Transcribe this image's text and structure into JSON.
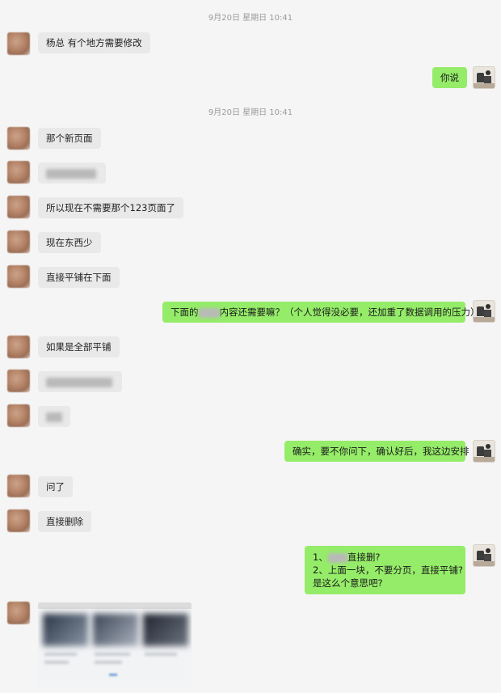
{
  "chat": {
    "timestamps": [
      "9月20日 星期日 10:41",
      "9月20日 星期日 10:41"
    ],
    "messages": {
      "m1": "杨总 有个地方需要修改",
      "m2": "你说",
      "m3": "那个新页面",
      "m5": "所以现在不需要那个123页面了",
      "m6": "现在东西少",
      "m7": "直接平铺在下面",
      "m8_pre": "下面的",
      "m8_post": "内容还需要嘛？（个人觉得没必要，还加重了数据调用的压力）",
      "m9": "如果是全部平铺",
      "m12": "确实，要不你问下，确认好后，我这边安排",
      "m13": "问了",
      "m14": "直接删除",
      "m15_line1_pre": "1、",
      "m15_line1_post": "直接删?",
      "m15_line2": "2、上面一块，不要分页，直接平铺?",
      "m15_line3": "是这么个意思吧?"
    }
  },
  "colors": {
    "incoming_bubble": "#e9e9e9",
    "outgoing_bubble": "#95ec69",
    "background": "#f5f5f5"
  }
}
